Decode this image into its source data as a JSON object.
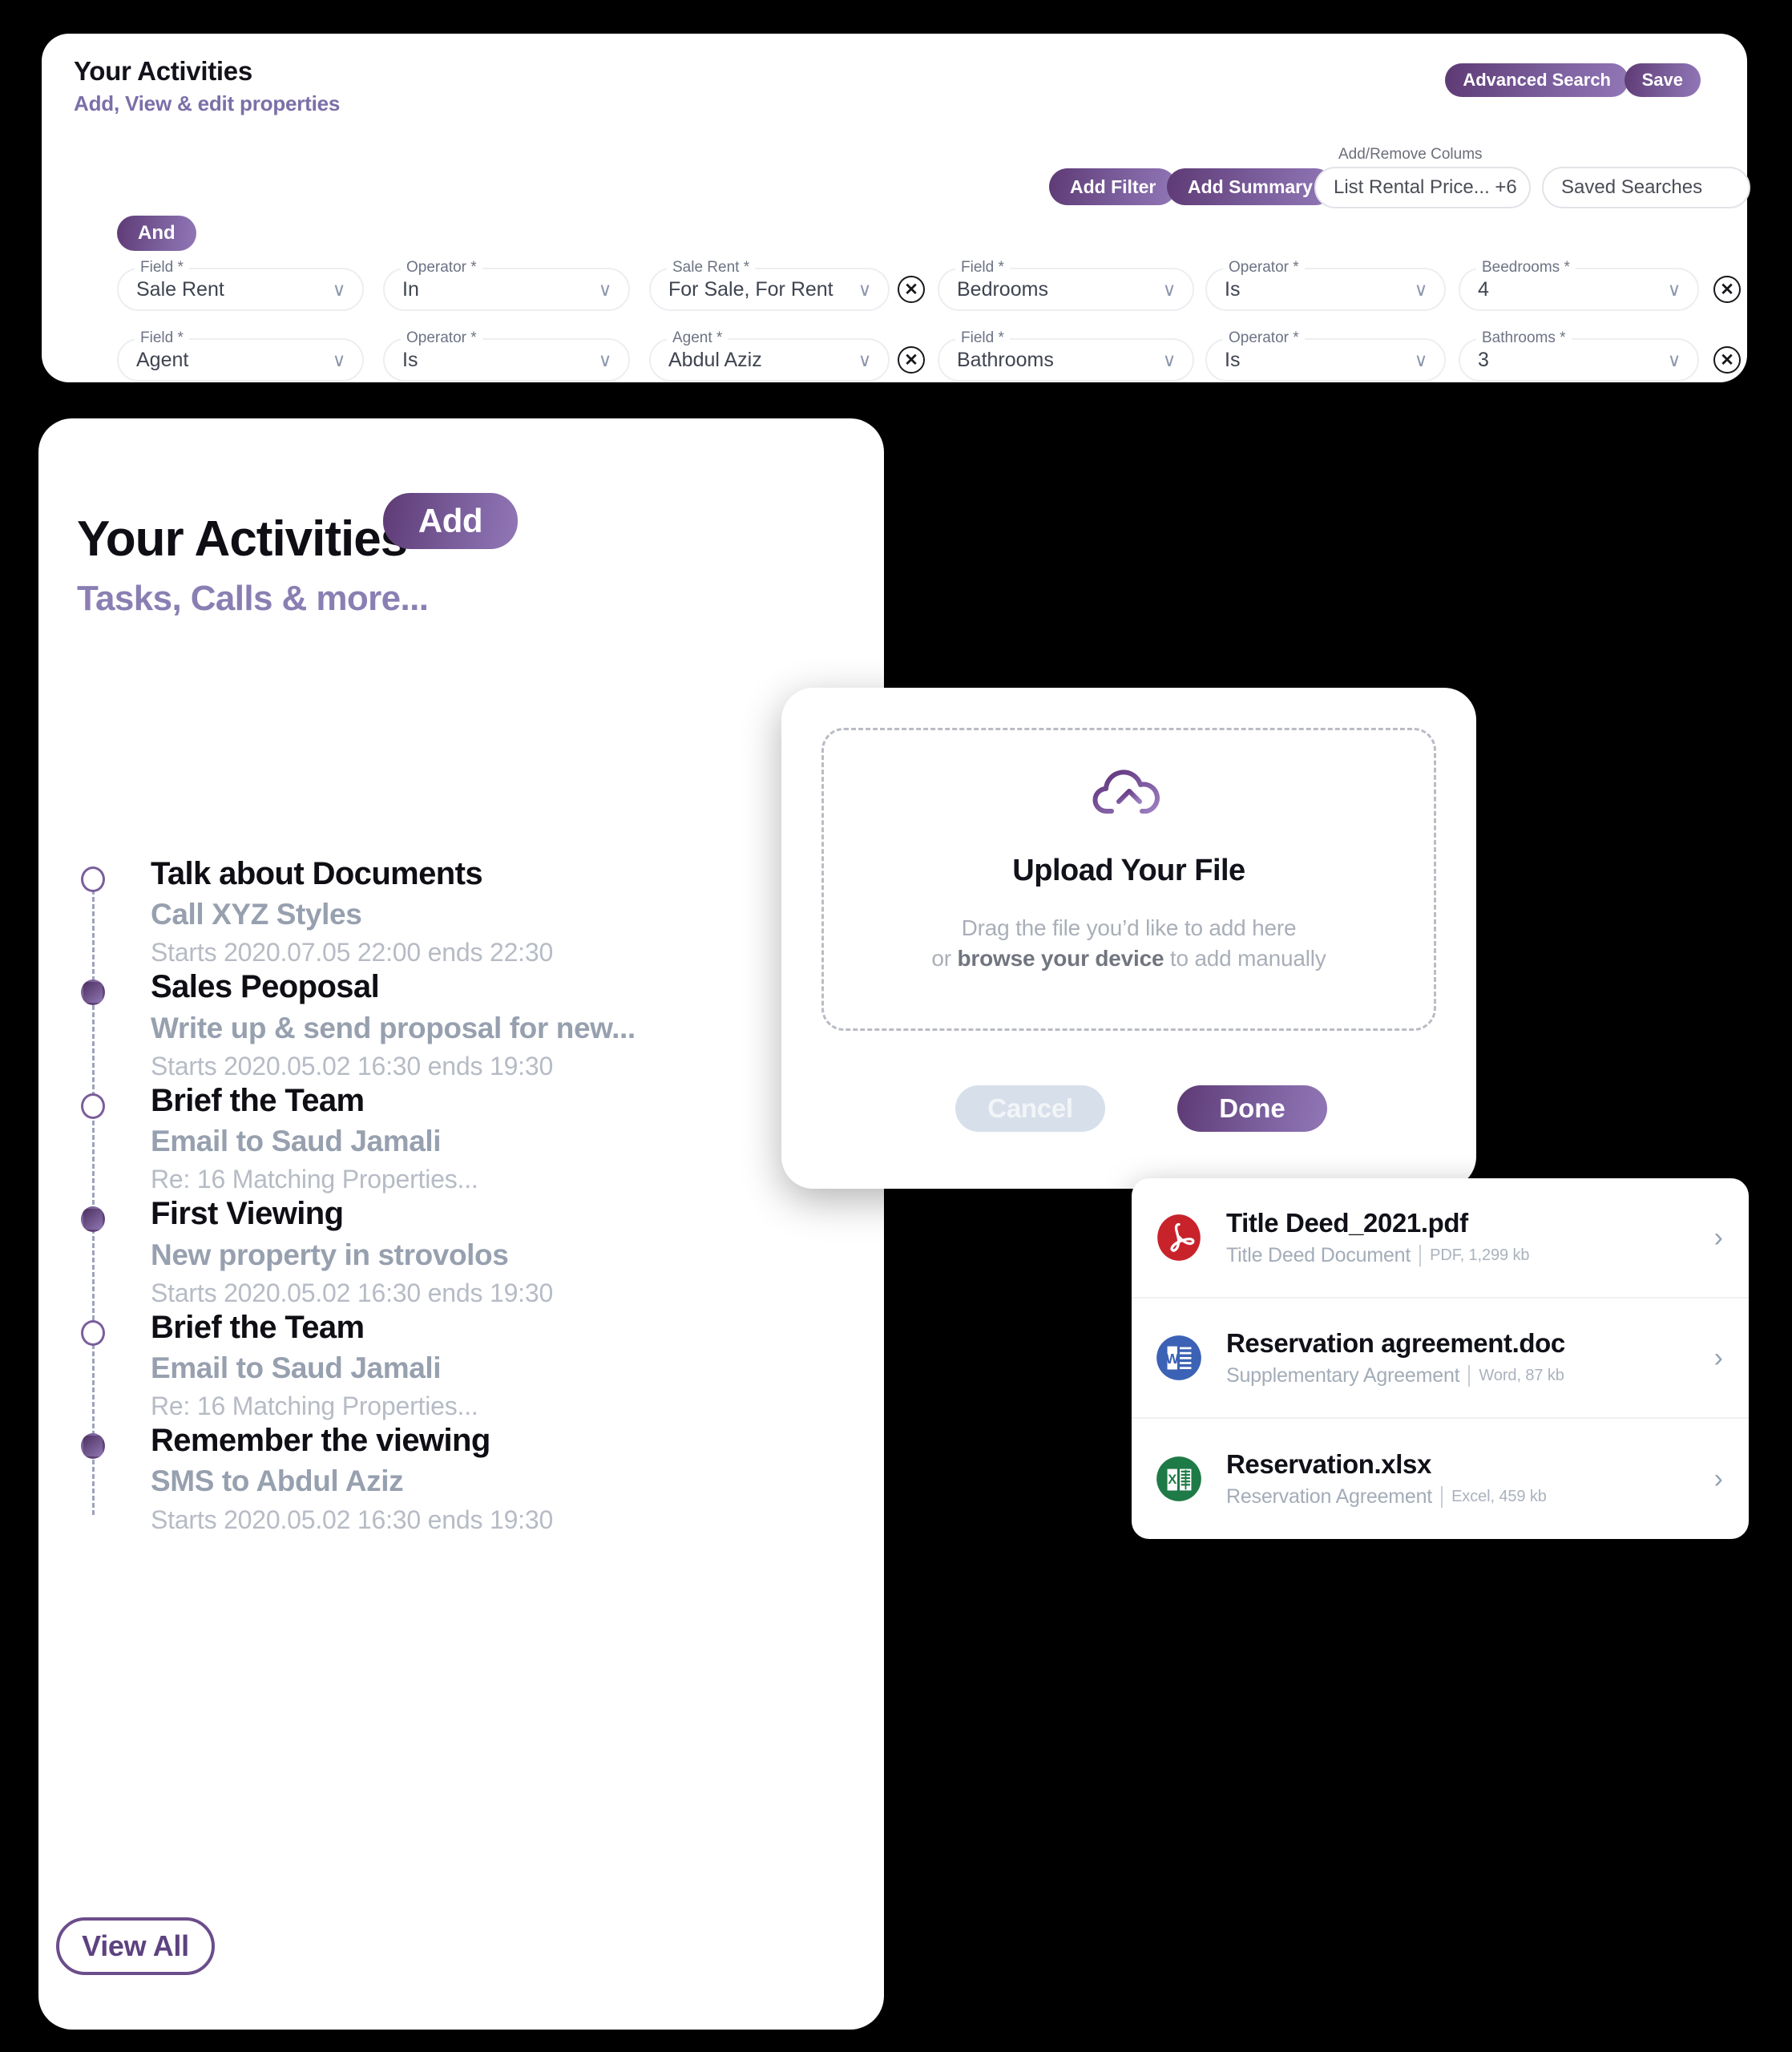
{
  "search_panel": {
    "title": "Your Activities",
    "subtitle": "Add, View & edit properties",
    "advanced_search_label": "Advanced Search",
    "save_label": "Save",
    "add_filter_label": "Add Filter",
    "add_summary_label": "Add Summary",
    "columns_label": "Add/Remove Colums",
    "columns_value": "List Rental Price... +6",
    "saved_searches_value": "Saved Searches",
    "conjunction_chip": "And",
    "remove_icon": "✕",
    "chevron_icon": "∨",
    "rows": [
      {
        "left": {
          "field_label": "Field *",
          "field_value": "Sale Rent",
          "operator_label": "Operator *",
          "operator_value": "In",
          "value_label": "Sale Rent *",
          "value_value": "For Sale, For Rent"
        },
        "right": {
          "field_label": "Field *",
          "field_value": "Bedrooms",
          "operator_label": "Operator *",
          "operator_value": "Is",
          "value_label": "Beedrooms *",
          "value_value": "4"
        }
      },
      {
        "left": {
          "field_label": "Field *",
          "field_value": "Agent",
          "operator_label": "Operator *",
          "operator_value": "Is",
          "value_label": "Agent *",
          "value_value": "Abdul Aziz"
        },
        "right": {
          "field_label": "Field *",
          "field_value": "Bathrooms",
          "operator_label": "Operator *",
          "operator_value": "Is",
          "value_label": "Bathrooms *",
          "value_value": "3"
        }
      }
    ]
  },
  "activities": {
    "title": "Your Activities",
    "subtitle": "Tasks, Calls & more...",
    "add_label": "Add",
    "view_all_label": "View All",
    "items": [
      {
        "title": "Talk about Documents",
        "desc": "Call XYZ Styles",
        "meta": "Starts 2020.07.05 22:00 ends 22:30",
        "state": "open"
      },
      {
        "title": "Sales Peoposal",
        "desc": "Write up & send proposal for new...",
        "meta": "Starts 2020.05.02 16:30 ends 19:30",
        "state": "filled"
      },
      {
        "title": "Brief the Team",
        "desc": "Email to Saud Jamali",
        "meta": "Re: 16 Matching Properties...",
        "state": "open"
      },
      {
        "title": "First Viewing",
        "desc": "New property in strovolos",
        "meta": "Starts 2020.05.02 16:30 ends 19:30",
        "state": "filled"
      },
      {
        "title": "Brief the Team",
        "desc": "Email to Saud Jamali",
        "meta": "Re: 16 Matching Properties...",
        "state": "open"
      },
      {
        "title": "Remember the viewing",
        "desc": "SMS to Abdul Aziz",
        "meta": "Starts 2020.05.02 16:30 ends 19:30",
        "state": "filled"
      }
    ]
  },
  "upload_modal": {
    "icon": "cloud-upload-icon",
    "title": "Upload Your File",
    "hint_line1": "Drag the file you’d like to add here",
    "hint_line2_pre": "or ",
    "hint_line2_strong": "browse your device",
    "hint_line2_post": " to add manually",
    "cancel_label": "Cancel",
    "done_label": "Done"
  },
  "file_list": {
    "chevron_icon": "›",
    "items": [
      {
        "name": "Title Deed_2021.pdf",
        "desc": "Title Deed Document",
        "size": "PDF, 1,299 kb",
        "type": "pdf"
      },
      {
        "name": "Reservation agreement.doc",
        "desc": "Supplementary Agreement",
        "size": "Word, 87 kb",
        "type": "word"
      },
      {
        "name": "Reservation.xlsx",
        "desc": "Reservation Agreement",
        "size": "Excel, 459 kb",
        "type": "excel"
      }
    ]
  },
  "colors": {
    "brand_purple_dark": "#5e3a74",
    "brand_purple_light": "#9277b7",
    "subtitle_purple": "#8a7fb3",
    "muted_gray": "#97a0af",
    "pdf_red": "#c8232b",
    "word_blue": "#3b62b5",
    "excel_green": "#1e7a46"
  }
}
